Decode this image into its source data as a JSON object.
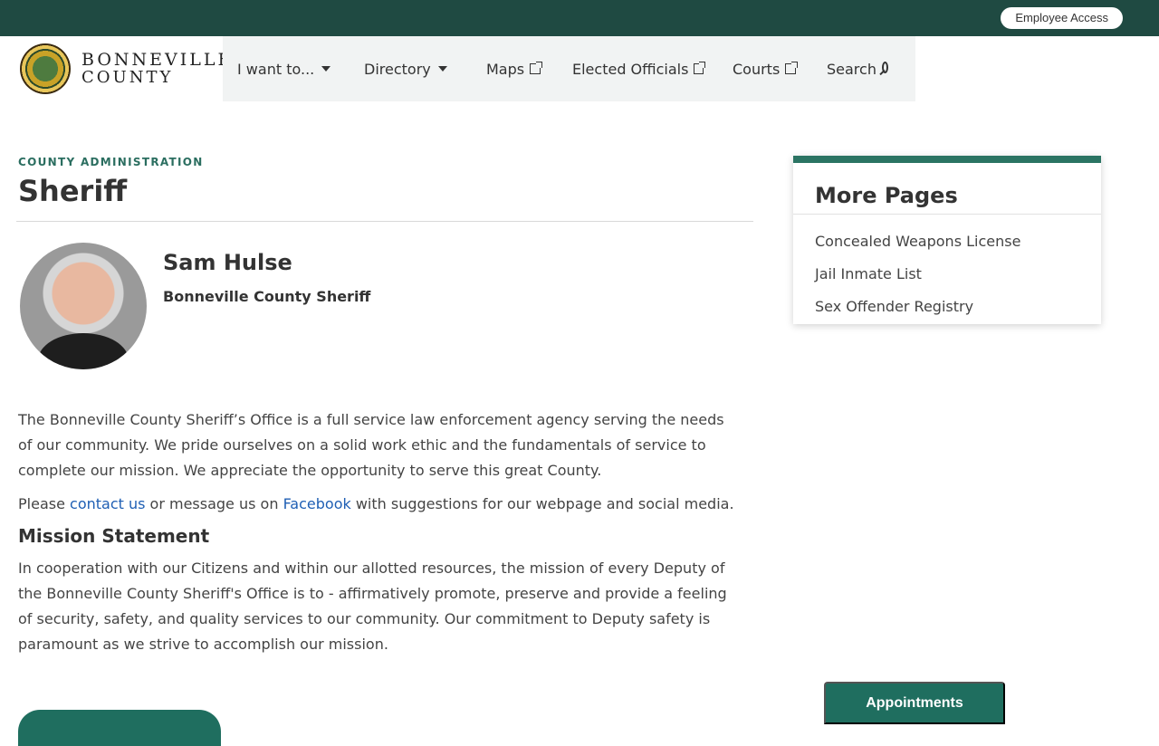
{
  "topbar": {
    "employee_access": "Employee Access"
  },
  "logo": {
    "line1": "BONNEVILLE",
    "line2": "COUNTY"
  },
  "nav": {
    "items": [
      {
        "label": "I want to..."
      },
      {
        "label": "Directory"
      },
      {
        "label": "Maps"
      },
      {
        "label": "Elected Officials"
      },
      {
        "label": "Courts"
      },
      {
        "label": "Search"
      }
    ]
  },
  "page": {
    "eyebrow": "COUNTY ADMINISTRATION",
    "title": "Sheriff"
  },
  "profile": {
    "name": "Sam Hulse",
    "title": "Bonneville County Sheriff"
  },
  "content": {
    "p1": "The Bonneville County Sheriff’s Office is a full service law enforcement agency serving the needs of our community. We pride ourselves on a solid work ethic and the fundamentals of service to complete our mission. We appreciate the opportunity to serve this great County.",
    "p2_before": "Please ",
    "p2_link1": "contact us",
    "p2_middle": " or message us on ",
    "p2_link2": "Facebook",
    "p2_after": " with suggestions for our webpage and social media.",
    "mission_heading": "Mission Statement",
    "mission_text": "In cooperation with our Citizens and within our allotted resources, the mission of every Deputy of the Bonneville County Sheriff's Office is to - affirmatively promote, preserve and provide a feeling of security, safety, and quality services to our community. Our commitment to Deputy safety is paramount as we strive to accomplish our mission."
  },
  "sidebar": {
    "title": "More Pages",
    "links": [
      "Concealed Weapons License",
      "Jail Inmate List",
      "Sex Offender Registry"
    ]
  },
  "appointments": {
    "label": "Appointments"
  },
  "colors": {
    "topbar": "#1f4a42",
    "accent": "#2b7463",
    "link": "#1f5fb4",
    "nav_bg": "#f1f3f3"
  },
  "icons": {
    "nav_dropdown": "caret-down-icon",
    "nav_external": "external-link-icon",
    "search": "search-icon"
  }
}
